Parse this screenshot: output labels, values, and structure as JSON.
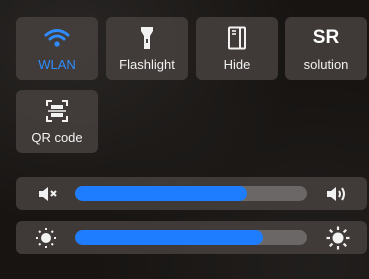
{
  "tiles": [
    {
      "id": "wlan",
      "label": "WLAN",
      "icon": "wifi-icon",
      "active": true
    },
    {
      "id": "flashlight",
      "label": "Flashlight",
      "icon": "flashlight-icon",
      "active": false
    },
    {
      "id": "hide",
      "label": "Hide",
      "icon": "hide-icon",
      "active": false
    },
    {
      "id": "resolution",
      "label": "solution",
      "icon_text": "SR",
      "icon": "sr-icon",
      "active": false
    },
    {
      "id": "qrcode",
      "label": "QR code",
      "icon": "qr-scan-icon",
      "active": false
    }
  ],
  "volume": {
    "level": 0.74,
    "mute_icon": "volume-mute-icon",
    "max_icon": "volume-up-icon"
  },
  "brightness": {
    "level": 0.81,
    "min_icon": "brightness-low-icon",
    "max_icon": "brightness-high-icon"
  },
  "colors": {
    "accent": "#2f8cff",
    "fill": "#1e7cff",
    "tile_bg": "#48423f",
    "track": "#6b6766"
  }
}
